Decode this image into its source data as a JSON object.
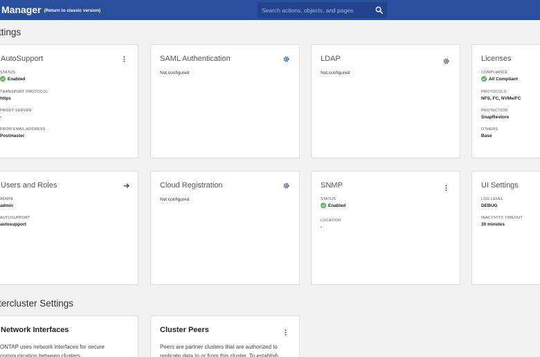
{
  "header": {
    "app_title": "Manager",
    "classic_link": "(Return to classic version)",
    "search_placeholder": "Search actions, objects, and pages"
  },
  "sections": {
    "settings_title": "ttings",
    "intercluster_title": "tercluster Settings"
  },
  "cards": {
    "autosupport": {
      "title": "AutoSupport",
      "fields": [
        {
          "label": "STATUS",
          "value": "Enabled"
        },
        {
          "label": "TRANSPORT PROTOCOL",
          "value": "https"
        },
        {
          "label": "PROXY SERVER",
          "value": "-"
        },
        {
          "label": "FROM EMAIL ADDRESS",
          "value": "Postmaster"
        }
      ]
    },
    "saml": {
      "title": "SAML Authentication",
      "status": "Not configured"
    },
    "ldap": {
      "title": "LDAP",
      "status": "Not configured"
    },
    "licenses": {
      "title": "Licenses",
      "fields": [
        {
          "label": "COMPLIANCE",
          "value": "All Compliant"
        },
        {
          "label": "PROTOCOLS",
          "value": "NFS, FC, NVMe/FC"
        },
        {
          "label": "PROTECTION",
          "value": "SnapRestore"
        },
        {
          "label": "OTHERS",
          "value": "Base"
        }
      ]
    },
    "users_roles": {
      "title": "Users and Roles",
      "fields": [
        {
          "label": "ADMIN",
          "value": "admin"
        },
        {
          "label": "AUTOSUPPORT",
          "value": "autosupport"
        }
      ]
    },
    "cloud_registration": {
      "title": "Cloud Registration",
      "status": "Not configured"
    },
    "snmp": {
      "title": "SNMP",
      "fields": [
        {
          "label": "STATUS",
          "value": "Enabled"
        },
        {
          "label": "LOCATION",
          "value": "-"
        }
      ]
    },
    "ui_settings": {
      "title": "UI Settings",
      "fields": [
        {
          "label": "LOG LEVEL",
          "value": "DEBUG"
        },
        {
          "label": "INACTIVITY TIMEOUT",
          "value": "30 minutes"
        }
      ]
    },
    "network_interfaces": {
      "title": "Network Interfaces",
      "desc": "ONTAP uses network interfaces for secure communication between clusters."
    },
    "cluster_peers": {
      "title": "Cluster Peers",
      "desc": "Peers are partner clusters that are authorized to replicate data to or from this cluster. To establish"
    }
  },
  "colors": {
    "header_bg": "#2a4f9c",
    "accent": "#2a4f9c",
    "success": "#5cb85c"
  }
}
